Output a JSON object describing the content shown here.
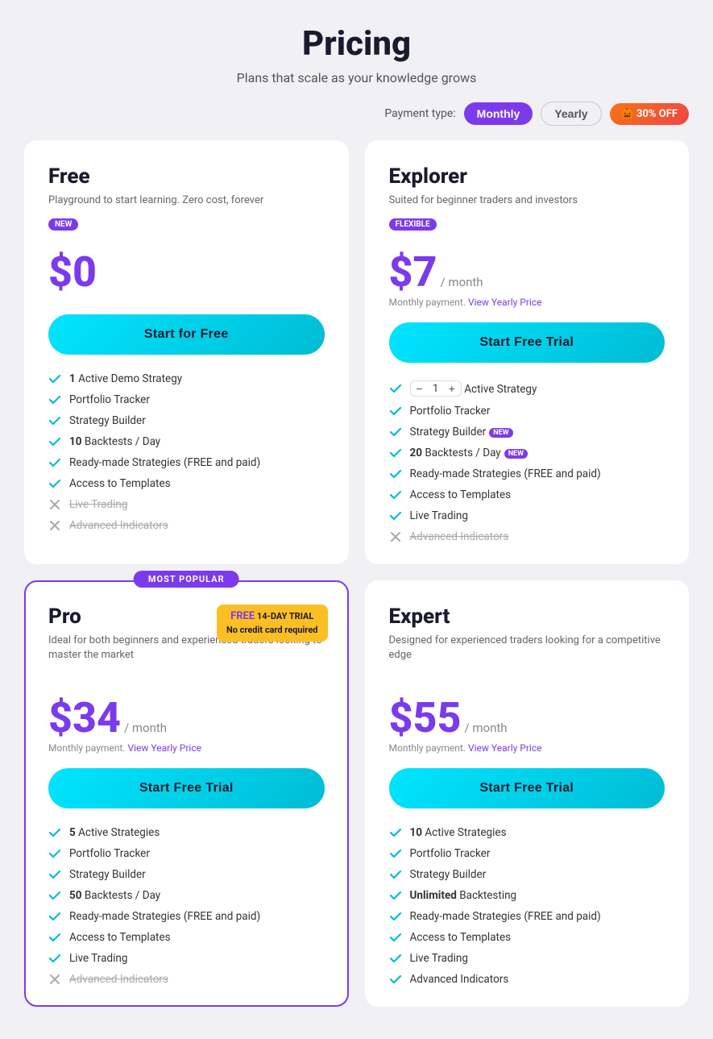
{
  "header": {
    "title": "Pricing",
    "subtitle": "Plans that scale as your knowledge grows"
  },
  "payment_toggle": {
    "label": "Payment type:",
    "monthly": "Monthly",
    "yearly": "Yearly",
    "discount": "🎃 30% OFF"
  },
  "plans": [
    {
      "id": "free",
      "name": "Free",
      "description": "Playground to start learning. Zero cost, forever",
      "badge": "NEW",
      "badge_type": "new",
      "price": "$0",
      "price_period": "",
      "price_note": "",
      "cta": "Start for Free",
      "popular": false,
      "trial_badge": null,
      "features": [
        {
          "text": "1 Active Demo Strategy",
          "enabled": true,
          "bold_prefix": "1",
          "tag": null
        },
        {
          "text": "Portfolio Tracker",
          "enabled": true,
          "bold_prefix": null,
          "tag": null
        },
        {
          "text": "Strategy Builder",
          "enabled": true,
          "bold_prefix": null,
          "tag": null
        },
        {
          "text": "10 Backtests / Day",
          "enabled": true,
          "bold_prefix": "10",
          "tag": null
        },
        {
          "text": "Ready-made Strategies (FREE and paid)",
          "enabled": true,
          "bold_prefix": null,
          "tag": null
        },
        {
          "text": "Access to Templates",
          "enabled": true,
          "bold_prefix": null,
          "tag": null
        },
        {
          "text": "Live Trading",
          "enabled": false,
          "bold_prefix": null,
          "tag": null
        },
        {
          "text": "Advanced Indicators",
          "enabled": false,
          "bold_prefix": null,
          "tag": null
        }
      ]
    },
    {
      "id": "explorer",
      "name": "Explorer",
      "description": "Suited for beginner traders and investors",
      "badge": "FLEXIBLE",
      "badge_type": "flexible",
      "price": "$7",
      "price_period": "/ month",
      "price_note": "Monthly payment.",
      "price_link": "View Yearly Price",
      "cta": "Start Free Trial",
      "popular": false,
      "trial_badge": null,
      "has_counter": true,
      "features": [
        {
          "text": "Active Strategy",
          "enabled": true,
          "bold_prefix": null,
          "tag": null,
          "counter": true
        },
        {
          "text": "Portfolio Tracker",
          "enabled": true,
          "bold_prefix": null,
          "tag": null
        },
        {
          "text": "Strategy Builder",
          "enabled": true,
          "bold_prefix": null,
          "tag": "NEW"
        },
        {
          "text": "20 Backtests / Day",
          "enabled": true,
          "bold_prefix": "20",
          "tag": "NEW"
        },
        {
          "text": "Ready-made Strategies (FREE and paid)",
          "enabled": true,
          "bold_prefix": null,
          "tag": null
        },
        {
          "text": "Access to Templates",
          "enabled": true,
          "bold_prefix": null,
          "tag": null
        },
        {
          "text": "Live Trading",
          "enabled": true,
          "bold_prefix": null,
          "tag": null
        },
        {
          "text": "Advanced Indicators",
          "enabled": false,
          "bold_prefix": null,
          "tag": null
        }
      ]
    },
    {
      "id": "pro",
      "name": "Pro",
      "description": "Ideal for both beginners and experienced traders looking to master the market",
      "badge": null,
      "price": "$34",
      "price_period": "/ month",
      "price_note": "Monthly payment.",
      "price_link": "View Yearly Price",
      "cta": "Start Free Trial",
      "popular": true,
      "popular_label": "MOST POPULAR",
      "trial_badge_line1": "FREE 14-DAY TRIAL",
      "trial_badge_line2": "No credit card required",
      "features": [
        {
          "text": "5 Active Strategies",
          "enabled": true,
          "bold_prefix": "5",
          "tag": null
        },
        {
          "text": "Portfolio Tracker",
          "enabled": true,
          "bold_prefix": null,
          "tag": null
        },
        {
          "text": "Strategy Builder",
          "enabled": true,
          "bold_prefix": null,
          "tag": null
        },
        {
          "text": "50 Backtests / Day",
          "enabled": true,
          "bold_prefix": "50",
          "tag": null
        },
        {
          "text": "Ready-made Strategies (FREE and paid)",
          "enabled": true,
          "bold_prefix": null,
          "tag": null
        },
        {
          "text": "Access to Templates",
          "enabled": true,
          "bold_prefix": null,
          "tag": null
        },
        {
          "text": "Live Trading",
          "enabled": true,
          "bold_prefix": null,
          "tag": null
        },
        {
          "text": "Advanced Indicators",
          "enabled": false,
          "bold_prefix": null,
          "tag": null
        }
      ]
    },
    {
      "id": "expert",
      "name": "Expert",
      "description": "Designed for experienced traders looking for a competitive edge",
      "badge": null,
      "price": "$55",
      "price_period": "/ month",
      "price_note": "Monthly payment.",
      "price_link": "View Yearly Price",
      "cta": "Start Free Trial",
      "popular": false,
      "trial_badge": null,
      "features": [
        {
          "text": "10 Active Strategies",
          "enabled": true,
          "bold_prefix": "10",
          "tag": null
        },
        {
          "text": "Portfolio Tracker",
          "enabled": true,
          "bold_prefix": null,
          "tag": null
        },
        {
          "text": "Strategy Builder",
          "enabled": true,
          "bold_prefix": null,
          "tag": null
        },
        {
          "text": "Unlimited Backtesting",
          "enabled": true,
          "bold_prefix": "Unlimited",
          "tag": null
        },
        {
          "text": "Ready-made Strategies (FREE and paid)",
          "enabled": true,
          "bold_prefix": null,
          "tag": null
        },
        {
          "text": "Access to Templates",
          "enabled": true,
          "bold_prefix": null,
          "tag": null
        },
        {
          "text": "Live Trading",
          "enabled": true,
          "bold_prefix": null,
          "tag": null
        },
        {
          "text": "Advanced Indicators",
          "enabled": true,
          "bold_prefix": null,
          "tag": null
        }
      ]
    }
  ]
}
